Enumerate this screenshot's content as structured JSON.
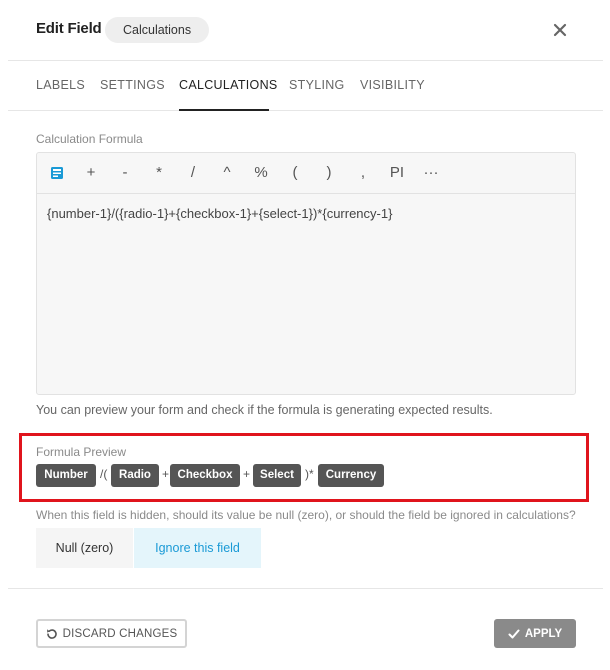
{
  "header": {
    "title": "Edit Field",
    "badge": "Calculations",
    "close_icon": "close-icon"
  },
  "tabs": [
    {
      "label": "LABELS",
      "active": false
    },
    {
      "label": "SETTINGS",
      "active": false
    },
    {
      "label": "CALCULATIONS",
      "active": true
    },
    {
      "label": "STYLING",
      "active": false
    },
    {
      "label": "VISIBILITY",
      "active": false
    }
  ],
  "calculation": {
    "label": "Calculation Formula",
    "toolbar": [
      {
        "name": "insert-field-icon",
        "label": ""
      },
      {
        "name": "plus-button",
        "label": "+"
      },
      {
        "name": "minus-button",
        "label": "-"
      },
      {
        "name": "multiply-button",
        "label": "*"
      },
      {
        "name": "divide-button",
        "label": "/"
      },
      {
        "name": "power-button",
        "label": "^"
      },
      {
        "name": "percent-button",
        "label": "%"
      },
      {
        "name": "open-paren-button",
        "label": "("
      },
      {
        "name": "close-paren-button",
        "label": ")"
      },
      {
        "name": "comma-button",
        "label": ","
      },
      {
        "name": "pi-button",
        "label": "PI"
      },
      {
        "name": "more-icon",
        "label": "···"
      }
    ],
    "formula": "{number-1}/({radio-1}+{checkbox-1}+{select-1})*{currency-1}",
    "hint": "You can preview your form and check if the formula is generating expected results."
  },
  "preview": {
    "label": "Formula Preview",
    "tokens": [
      {
        "type": "chip",
        "text": "Number"
      },
      {
        "type": "op",
        "text": "/("
      },
      {
        "type": "chip",
        "text": "Radio"
      },
      {
        "type": "op",
        "text": "+"
      },
      {
        "type": "chip",
        "text": "Checkbox"
      },
      {
        "type": "op",
        "text": "+"
      },
      {
        "type": "chip",
        "text": "Select"
      },
      {
        "type": "op",
        "text": ")*"
      },
      {
        "type": "chip",
        "text": "Currency"
      }
    ],
    "highlight_color": "#e0141c"
  },
  "hidden_behavior": {
    "question": "When this field is hidden, should its value be null (zero), or should the field be ignored in calculations?",
    "options": [
      {
        "label": "Null (zero)",
        "selected": false
      },
      {
        "label": "Ignore this field",
        "selected": true
      }
    ],
    "accent": "#1a9ad6"
  },
  "footer": {
    "discard_label": "DISCARD CHANGES",
    "discard_icon": "undo-icon",
    "apply_label": "APPLY",
    "apply_icon": "check-icon"
  }
}
